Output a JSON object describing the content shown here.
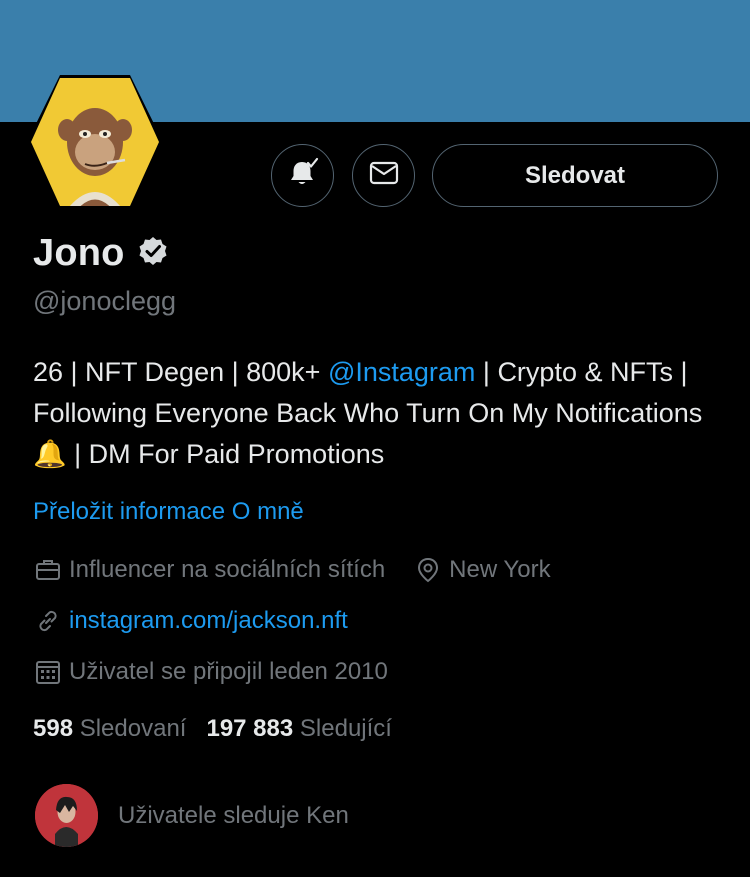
{
  "profile": {
    "name": "Jono",
    "handle": "@jonoclegg",
    "bio": {
      "part1": "26 | NFT Degen | 800k+ ",
      "mention": "@Instagram",
      "part2": " | Crypto & NFTs | Following Everyone Back Who Turn On My Notifications ",
      "emoji": "🔔",
      "part3": " | DM For Paid Promotions"
    },
    "translate_label": "Přeložit informace O mně",
    "category": "Influencer na sociálních sítích",
    "location": "New York",
    "website": "instagram.com/jackson.nft",
    "joined": "Uživatel se připojil leden 2010"
  },
  "actions": {
    "follow_label": "Sledovat"
  },
  "stats": {
    "following_count": "598",
    "following_label": "Sledovaní",
    "followers_count": "197 883",
    "followers_label": "Sledující"
  },
  "followed_by": {
    "text": "Uživatele sleduje Ken"
  },
  "colors": {
    "banner": "#3a7fab",
    "accent": "#1d9bf0",
    "muted": "#71767b"
  },
  "icons": [
    "notification-bell-icon",
    "mail-icon",
    "verified-badge-icon",
    "briefcase-icon",
    "location-pin-icon",
    "link-icon",
    "calendar-icon"
  ]
}
